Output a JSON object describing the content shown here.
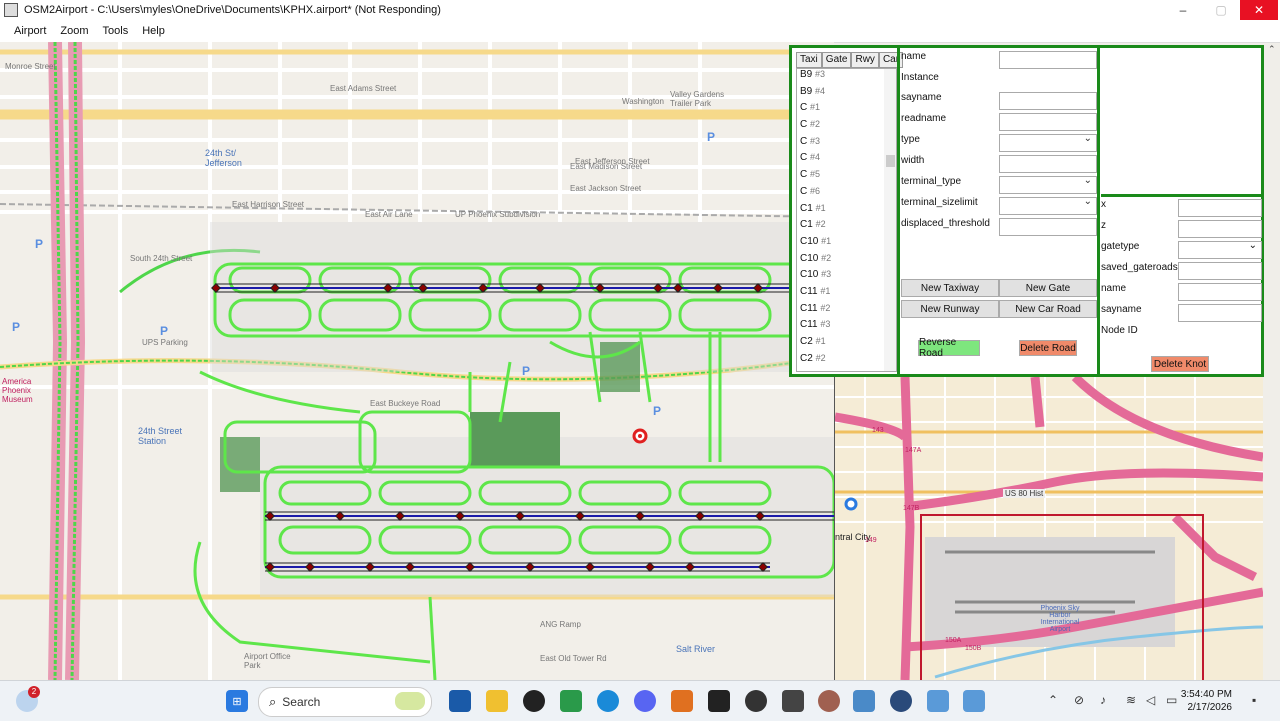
{
  "window": {
    "title": "OSM2Airport - C:\\Users\\myles\\OneDrive\\Documents\\KPHX.airport* (Not Responding)",
    "minimize": "–",
    "maximize": "▢",
    "close": "✕"
  },
  "menu": {
    "items": [
      "Airport",
      "Zoom",
      "Tools",
      "Help"
    ]
  },
  "map_labels": {
    "monroe": "Monroe Street",
    "adams": "East Adams Street",
    "washington": "Washington Street",
    "jefferson": "East Jefferson Street",
    "madison": "East Madison Street",
    "jackson": "East Jackson Street",
    "harrison": "East Harrison Street",
    "air_lane": "East Air Lane",
    "up_phoenix": "UP Phoenix Subdivision",
    "jefferson_st": "24th St/ Jefferson",
    "south24": "South 24th Street",
    "ups": "UPS Parking",
    "buckeye": "East Buckeye Road",
    "station": "24th Street Station",
    "valley": "Valley Gardens Trailer Park",
    "washington2": "Washington",
    "office": "Airport Office Park",
    "ang": "ANG Ramp",
    "old_tower": "East Old Tower Rd",
    "salt_river": "Salt River",
    "america": "America Phoenix Museum"
  },
  "panel": {
    "tabs": [
      "Taxi",
      "Gate",
      "Rwy",
      "Car"
    ],
    "list": [
      {
        "name": "B9",
        "num": "#3"
      },
      {
        "name": "B9",
        "num": "#4"
      },
      {
        "name": "C",
        "num": "#1"
      },
      {
        "name": "C",
        "num": "#2"
      },
      {
        "name": "C",
        "num": "#3"
      },
      {
        "name": "C",
        "num": "#4"
      },
      {
        "name": "C",
        "num": "#5"
      },
      {
        "name": "C",
        "num": "#6"
      },
      {
        "name": "C1",
        "num": "#1"
      },
      {
        "name": "C1",
        "num": "#2"
      },
      {
        "name": "C10",
        "num": "#1"
      },
      {
        "name": "C10",
        "num": "#2"
      },
      {
        "name": "C10",
        "num": "#3"
      },
      {
        "name": "C11",
        "num": "#1"
      },
      {
        "name": "C11",
        "num": "#2"
      },
      {
        "name": "C11",
        "num": "#3"
      },
      {
        "name": "C2",
        "num": "#1"
      },
      {
        "name": "C2",
        "num": "#2"
      }
    ],
    "fields": [
      "name",
      "Instance",
      "sayname",
      "readname",
      "type",
      "width",
      "terminal_type",
      "terminal_sizelimit",
      "displaced_threshold"
    ],
    "buttons": {
      "new_taxiway": "New Taxiway",
      "new_gate": "New Gate",
      "new_runway": "New Runway",
      "new_car_road": "New Car Road",
      "reverse_road": "Reverse Road",
      "delete_road": "Delete Road",
      "delete_knot": "Delete Knot"
    },
    "node_fields": [
      "x",
      "z",
      "gatetype",
      "saved_gateroads",
      "name",
      "sayname",
      "Node ID"
    ]
  },
  "minimap": {
    "hwy_label": "US 80 Hist",
    "airport": "Phoenix Sky Harbor International Airport",
    "city": "ntral City",
    "r143": "143",
    "r147a": "147A",
    "r147b": "147B",
    "r149": "149",
    "r150a": "150A",
    "r150b": "150B"
  },
  "taskbar": {
    "search": "Search",
    "time": "3:54:40 PM",
    "date": "2/17/2026",
    "badge": "2"
  },
  "colors": {
    "accent": "#1a8a1a",
    "taxi": "#5ee64a",
    "runway": "#1a1aa8",
    "node": "#8b0000"
  }
}
